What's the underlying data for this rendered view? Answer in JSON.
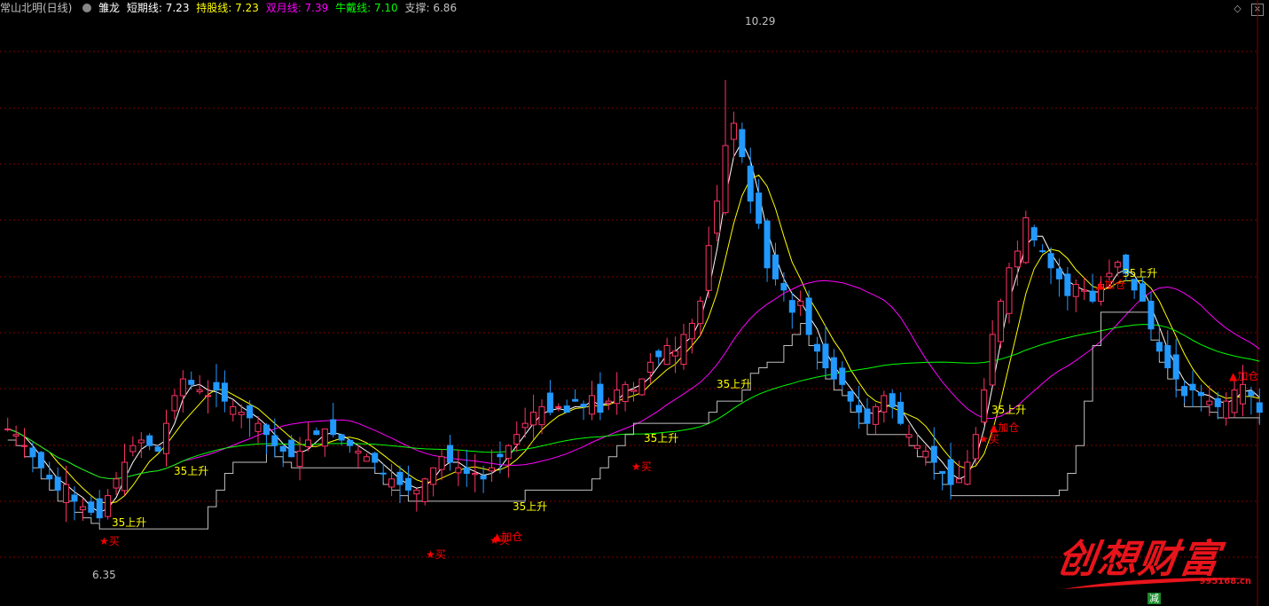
{
  "header": {
    "stock_label": "常山北明(日线)",
    "indicator_name": "雏龙",
    "items": [
      {
        "label": "短期线: 7.23",
        "color": "#ffffff"
      },
      {
        "label": "持股线: 7.23",
        "color": "#ffff00"
      },
      {
        "label": "双月线: 7.39",
        "color": "#ff00ff"
      },
      {
        "label": "牛戴线: 7.10",
        "color": "#00ff00"
      },
      {
        "label": "支撑: 6.86",
        "color": "#c0c0c0"
      }
    ]
  },
  "brand": {
    "title": "创想财富",
    "url": "995168.cn"
  },
  "bottom_tag": "减",
  "colors": {
    "up": "#ff3366",
    "down": "#2299ff",
    "short": "#ffffff",
    "hold": "#ffff00",
    "month": "#ff00ff",
    "bull": "#00ff00",
    "support": "#c0c0c0",
    "grid": "#800000",
    "signal": "#ff0000",
    "rise": "#ffff00"
  },
  "chart_data": {
    "type": "candlestick",
    "ylim": [
      5.9,
      10.85
    ],
    "grid": true,
    "closes": [
      7.15,
      7.1,
      7.0,
      6.9,
      6.8,
      6.7,
      6.6,
      6.65,
      6.5,
      6.45,
      6.4,
      6.35,
      6.55,
      6.7,
      6.85,
      7.0,
      7.05,
      7.0,
      6.95,
      7.2,
      7.45,
      7.6,
      7.55,
      7.5,
      7.45,
      7.5,
      7.4,
      7.35,
      7.3,
      7.25,
      7.2,
      7.1,
      7.0,
      6.95,
      6.9,
      6.95,
      7.05,
      7.1,
      7.15,
      7.1,
      7.05,
      7.0,
      6.95,
      6.9,
      6.85,
      6.75,
      6.7,
      6.65,
      6.6,
      6.6,
      6.7,
      6.8,
      6.9,
      6.85,
      6.8,
      6.75,
      6.75,
      6.7,
      6.8,
      6.9,
      7.0,
      7.1,
      7.2,
      7.3,
      7.35,
      7.3,
      7.35,
      7.3,
      7.4,
      7.35,
      7.45,
      7.3,
      7.4,
      7.5,
      7.55,
      7.5,
      7.6,
      7.75,
      7.8,
      7.9,
      7.85,
      8.0,
      8.1,
      8.3,
      8.8,
      9.2,
      9.7,
      9.9,
      9.6,
      9.2,
      9.0,
      8.6,
      8.5,
      8.4,
      8.2,
      8.3,
      8.0,
      7.85,
      7.7,
      7.6,
      7.55,
      7.4,
      7.3,
      7.2,
      7.35,
      7.45,
      7.35,
      7.2,
      7.1,
      7.0,
      6.95,
      6.85,
      6.75,
      6.65,
      6.7,
      6.85,
      7.1,
      7.5,
      8.0,
      8.3,
      8.6,
      8.75,
      9.05,
      8.85,
      8.75,
      8.6,
      8.5,
      8.35,
      8.45,
      8.4,
      8.3,
      8.45,
      8.55,
      8.65,
      8.55,
      8.4,
      8.3,
      8.05,
      7.85,
      7.7,
      7.6,
      7.45,
      7.5,
      7.45,
      7.4,
      7.35,
      7.4,
      7.5,
      7.55,
      7.45,
      7.3
    ],
    "highs_max": 10.29,
    "lows_min": 6.35,
    "annotations": [
      {
        "text": "10.29"
      },
      {
        "text": "6.35"
      },
      {
        "text": "35上升"
      },
      {
        "text": "35上升"
      },
      {
        "text": "35上升"
      },
      {
        "text": "35上升"
      },
      {
        "text": "35上升"
      },
      {
        "text": "35上升"
      },
      {
        "text": "35上升"
      },
      {
        "text": "★买"
      },
      {
        "text": "★买"
      },
      {
        "text": "★买"
      },
      {
        "text": "★买"
      },
      {
        "text": "★买"
      },
      {
        "text": "▲加仓"
      },
      {
        "text": "▲加仓"
      },
      {
        "text": "▲加仓"
      },
      {
        "text": "▲加仓"
      }
    ]
  }
}
